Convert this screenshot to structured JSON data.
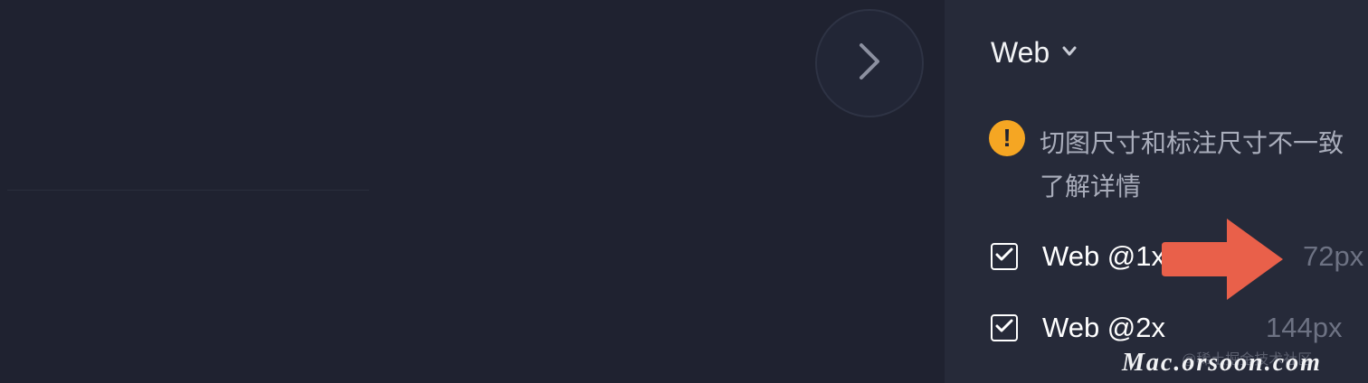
{
  "panel": {
    "platform_selector": {
      "value": "Web"
    },
    "warning": {
      "message": "切图尺寸和标注尺寸不一致",
      "link": "了解详情",
      "color": "#f5a623"
    },
    "export_options": [
      {
        "label": "Web @1x",
        "size": "72px",
        "checked": true
      },
      {
        "label": "Web @2x",
        "size": "144px",
        "checked": true
      }
    ]
  },
  "watermark": {
    "site_cn": "@稀土掘金技术社区",
    "site": "Mac.orsoon.com"
  },
  "colors": {
    "canvas_bg": "#1f2230",
    "panel_bg": "#262a39",
    "arrow": "#e9604a"
  }
}
